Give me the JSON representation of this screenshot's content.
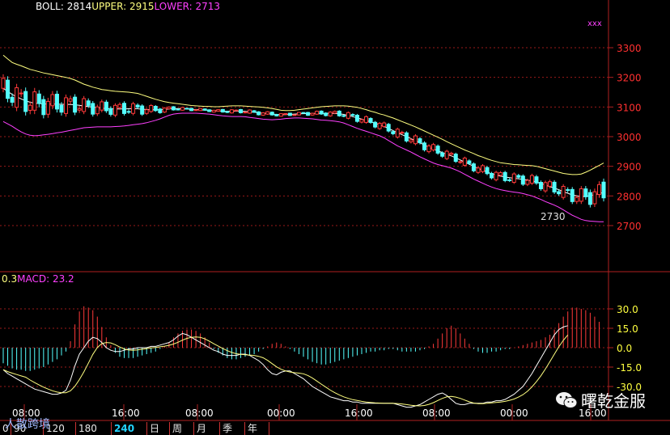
{
  "boll": {
    "label": "BOLL:",
    "mid": "2814",
    "upper_label": "UPPER:",
    "upper": "2915",
    "lower_label": "LOWER:",
    "lower": "2713"
  },
  "macd_header": {
    "prefix": "0.3",
    "label": "MACD:",
    "value": "23.2"
  },
  "price_ticks": [
    "3300",
    "3200",
    "3100",
    "3000",
    "2900",
    "2800",
    "2700"
  ],
  "macd_ticks": [
    "30.0",
    "15.0",
    "0.0",
    "-15.0",
    "-30.0"
  ],
  "time_labels": [
    "08:00",
    "16:00",
    "08:00",
    "00:00",
    "16:00",
    "08:00",
    "00:00",
    "16:00"
  ],
  "low_annotation": "2730",
  "corner_mark": "xxx",
  "period_tabs": [
    "0",
    "90",
    "120",
    "180",
    "240",
    "日",
    "周",
    "月",
    "季",
    "年"
  ],
  "active_tab": "240",
  "watermark_left": "人散跨境",
  "watermark_right": "曙乾金服",
  "colors": {
    "up": "#ff3a3a",
    "down": "#54ffff",
    "mid": "#ffffff",
    "upper": "#ffff80",
    "lower": "#ff40ff",
    "grid": "#9a1a1a",
    "axis": "#b02020"
  },
  "chart_data": [
    {
      "type": "candlestick",
      "title": "BOLL",
      "ylim": [
        2600,
        3360
      ],
      "y_ticks": [
        3300,
        3200,
        3100,
        3000,
        2900,
        2800,
        2700
      ],
      "x_labels": [
        "08:00",
        "16:00",
        "08:00",
        "00:00",
        "16:00",
        "08:00",
        "00:00",
        "16:00"
      ],
      "series": [
        {
          "name": "UPPER",
          "values": [
            3275,
            3262,
            3250,
            3244,
            3239,
            3233,
            3227,
            3223,
            3219,
            3215,
            3212,
            3209,
            3206,
            3203,
            3200,
            3196,
            3191,
            3184,
            3177,
            3172,
            3167,
            3163,
            3159,
            3157,
            3155,
            3153,
            3152,
            3151,
            3150,
            3148,
            3146,
            3141,
            3136,
            3131,
            3126,
            3122,
            3118,
            3115,
            3113,
            3111,
            3109,
            3107,
            3105,
            3104,
            3103,
            3102,
            3102,
            3101,
            3101,
            3102,
            3103,
            3104,
            3104,
            3104,
            3103,
            3102,
            3101,
            3100,
            3099,
            3097,
            3095,
            3092,
            3089,
            3088,
            3088,
            3089,
            3091,
            3093,
            3095,
            3097,
            3099,
            3101,
            3102,
            3103,
            3104,
            3104,
            3104,
            3103,
            3101,
            3099,
            3095,
            3091,
            3086,
            3082,
            3077,
            3073,
            3068,
            3063,
            3057,
            3051,
            3045,
            3039,
            3033,
            3026,
            3019,
            3012,
            3005,
            2998,
            2991,
            2983,
            2976,
            2969,
            2962,
            2955,
            2949,
            2943,
            2936,
            2931,
            2925,
            2920,
            2916,
            2912,
            2910,
            2908,
            2906,
            2905,
            2904,
            2903,
            2902,
            2900,
            2896,
            2892,
            2888,
            2884,
            2880,
            2876,
            2874,
            2872,
            2872,
            2874,
            2880,
            2887,
            2895,
            2903,
            2911
          ]
        },
        {
          "name": "LOWER",
          "values": [
            3051,
            3043,
            3035,
            3025,
            3016,
            3009,
            3005,
            3003,
            3004,
            3006,
            3008,
            3010,
            3013,
            3015,
            3018,
            3021,
            3024,
            3027,
            3030,
            3031,
            3032,
            3033,
            3033,
            3033,
            3033,
            3034,
            3035,
            3036,
            3038,
            3040,
            3042,
            3044,
            3047,
            3051,
            3055,
            3060,
            3066,
            3072,
            3076,
            3078,
            3079,
            3079,
            3079,
            3079,
            3078,
            3077,
            3076,
            3074,
            3072,
            3070,
            3069,
            3068,
            3068,
            3068,
            3067,
            3065,
            3063,
            3061,
            3059,
            3058,
            3057,
            3058,
            3059,
            3061,
            3062,
            3063,
            3063,
            3062,
            3061,
            3060,
            3058,
            3056,
            3055,
            3054,
            3052,
            3050,
            3046,
            3040,
            3034,
            3028,
            3023,
            3018,
            3013,
            3008,
            3003,
            2996,
            2987,
            2978,
            2969,
            2962,
            2955,
            2948,
            2940,
            2932,
            2925,
            2918,
            2911,
            2906,
            2902,
            2898,
            2894,
            2888,
            2881,
            2873,
            2865,
            2857,
            2850,
            2843,
            2836,
            2830,
            2825,
            2821,
            2818,
            2815,
            2813,
            2811,
            2808,
            2804,
            2800,
            2794,
            2788,
            2781,
            2775,
            2769,
            2762,
            2753,
            2744,
            2735,
            2728,
            2721,
            2717,
            2715,
            2714,
            2713,
            2713
          ]
        }
      ]
    },
    {
      "type": "bar",
      "title": "MACD",
      "ylim": [
        -48,
        40
      ],
      "y_ticks": [
        30,
        15,
        0,
        -15,
        -30
      ],
      "values": [
        -12,
        -14,
        -16,
        -17,
        -17,
        -18,
        -18,
        -17,
        -16,
        -15,
        -13,
        -11,
        -9,
        -6,
        -3,
        5,
        18,
        28,
        32,
        31,
        29,
        24,
        16,
        8,
        2,
        -4,
        -7,
        -8,
        -8,
        -8,
        -7,
        -6,
        -5,
        -4,
        -3,
        -1,
        1,
        4,
        8,
        11,
        13,
        14,
        14,
        13,
        11,
        8,
        4,
        -1,
        -4,
        -6,
        -8,
        -9,
        -9,
        -8,
        -7,
        -6,
        -5,
        -3,
        -1,
        1,
        3,
        4,
        3,
        1,
        -1,
        -3,
        -5,
        -7,
        -9,
        -11,
        -12,
        -13,
        -13,
        -12,
        -11,
        -10,
        -9,
        -8,
        -7,
        -6,
        -5,
        -4,
        -3,
        -3,
        -2,
        -2,
        -1,
        -1,
        -2,
        -3,
        -3,
        -3,
        -3,
        -2,
        -1,
        1,
        3,
        7,
        11,
        15,
        17,
        15,
        11,
        7,
        3,
        -1,
        -3,
        -4,
        -4,
        -3,
        -3,
        -2,
        -1,
        -1,
        0,
        1,
        2,
        3,
        4,
        5,
        6,
        8,
        10,
        14,
        19,
        24,
        28,
        31,
        31,
        30,
        29,
        27,
        24,
        20
      ],
      "dif": [
        -17,
        -20,
        -22,
        -24,
        -26,
        -28,
        -30,
        -32,
        -33,
        -34,
        -35,
        -36,
        -36,
        -35,
        -33,
        -25,
        -14,
        -5,
        0,
        5,
        8,
        7,
        4,
        0,
        -2,
        -3,
        -3,
        -2,
        -1,
        -1,
        0,
        0,
        0,
        1,
        1,
        2,
        3,
        4,
        6,
        9,
        11,
        10,
        8,
        6,
        4,
        2,
        0,
        -2,
        -3,
        -5,
        -6,
        -6,
        -6,
        -5,
        -5,
        -6,
        -8,
        -10,
        -13,
        -17,
        -20,
        -21,
        -19,
        -18,
        -18,
        -20,
        -22,
        -24,
        -27,
        -30,
        -32,
        -34,
        -36,
        -38,
        -39,
        -40,
        -41,
        -41,
        -42,
        -42,
        -43,
        -43,
        -43,
        -43,
        -43,
        -43,
        -43,
        -43,
        -44,
        -45,
        -46,
        -46,
        -45,
        -44,
        -42,
        -40,
        -38,
        -36,
        -35,
        -37,
        -40,
        -43,
        -44,
        -44,
        -43,
        -43,
        -43,
        -43,
        -42,
        -42,
        -41,
        -41,
        -40,
        -38,
        -36,
        -33,
        -30,
        -25,
        -20,
        -14,
        -8,
        -2,
        4,
        10,
        14,
        16,
        17
      ]
    }
  ]
}
